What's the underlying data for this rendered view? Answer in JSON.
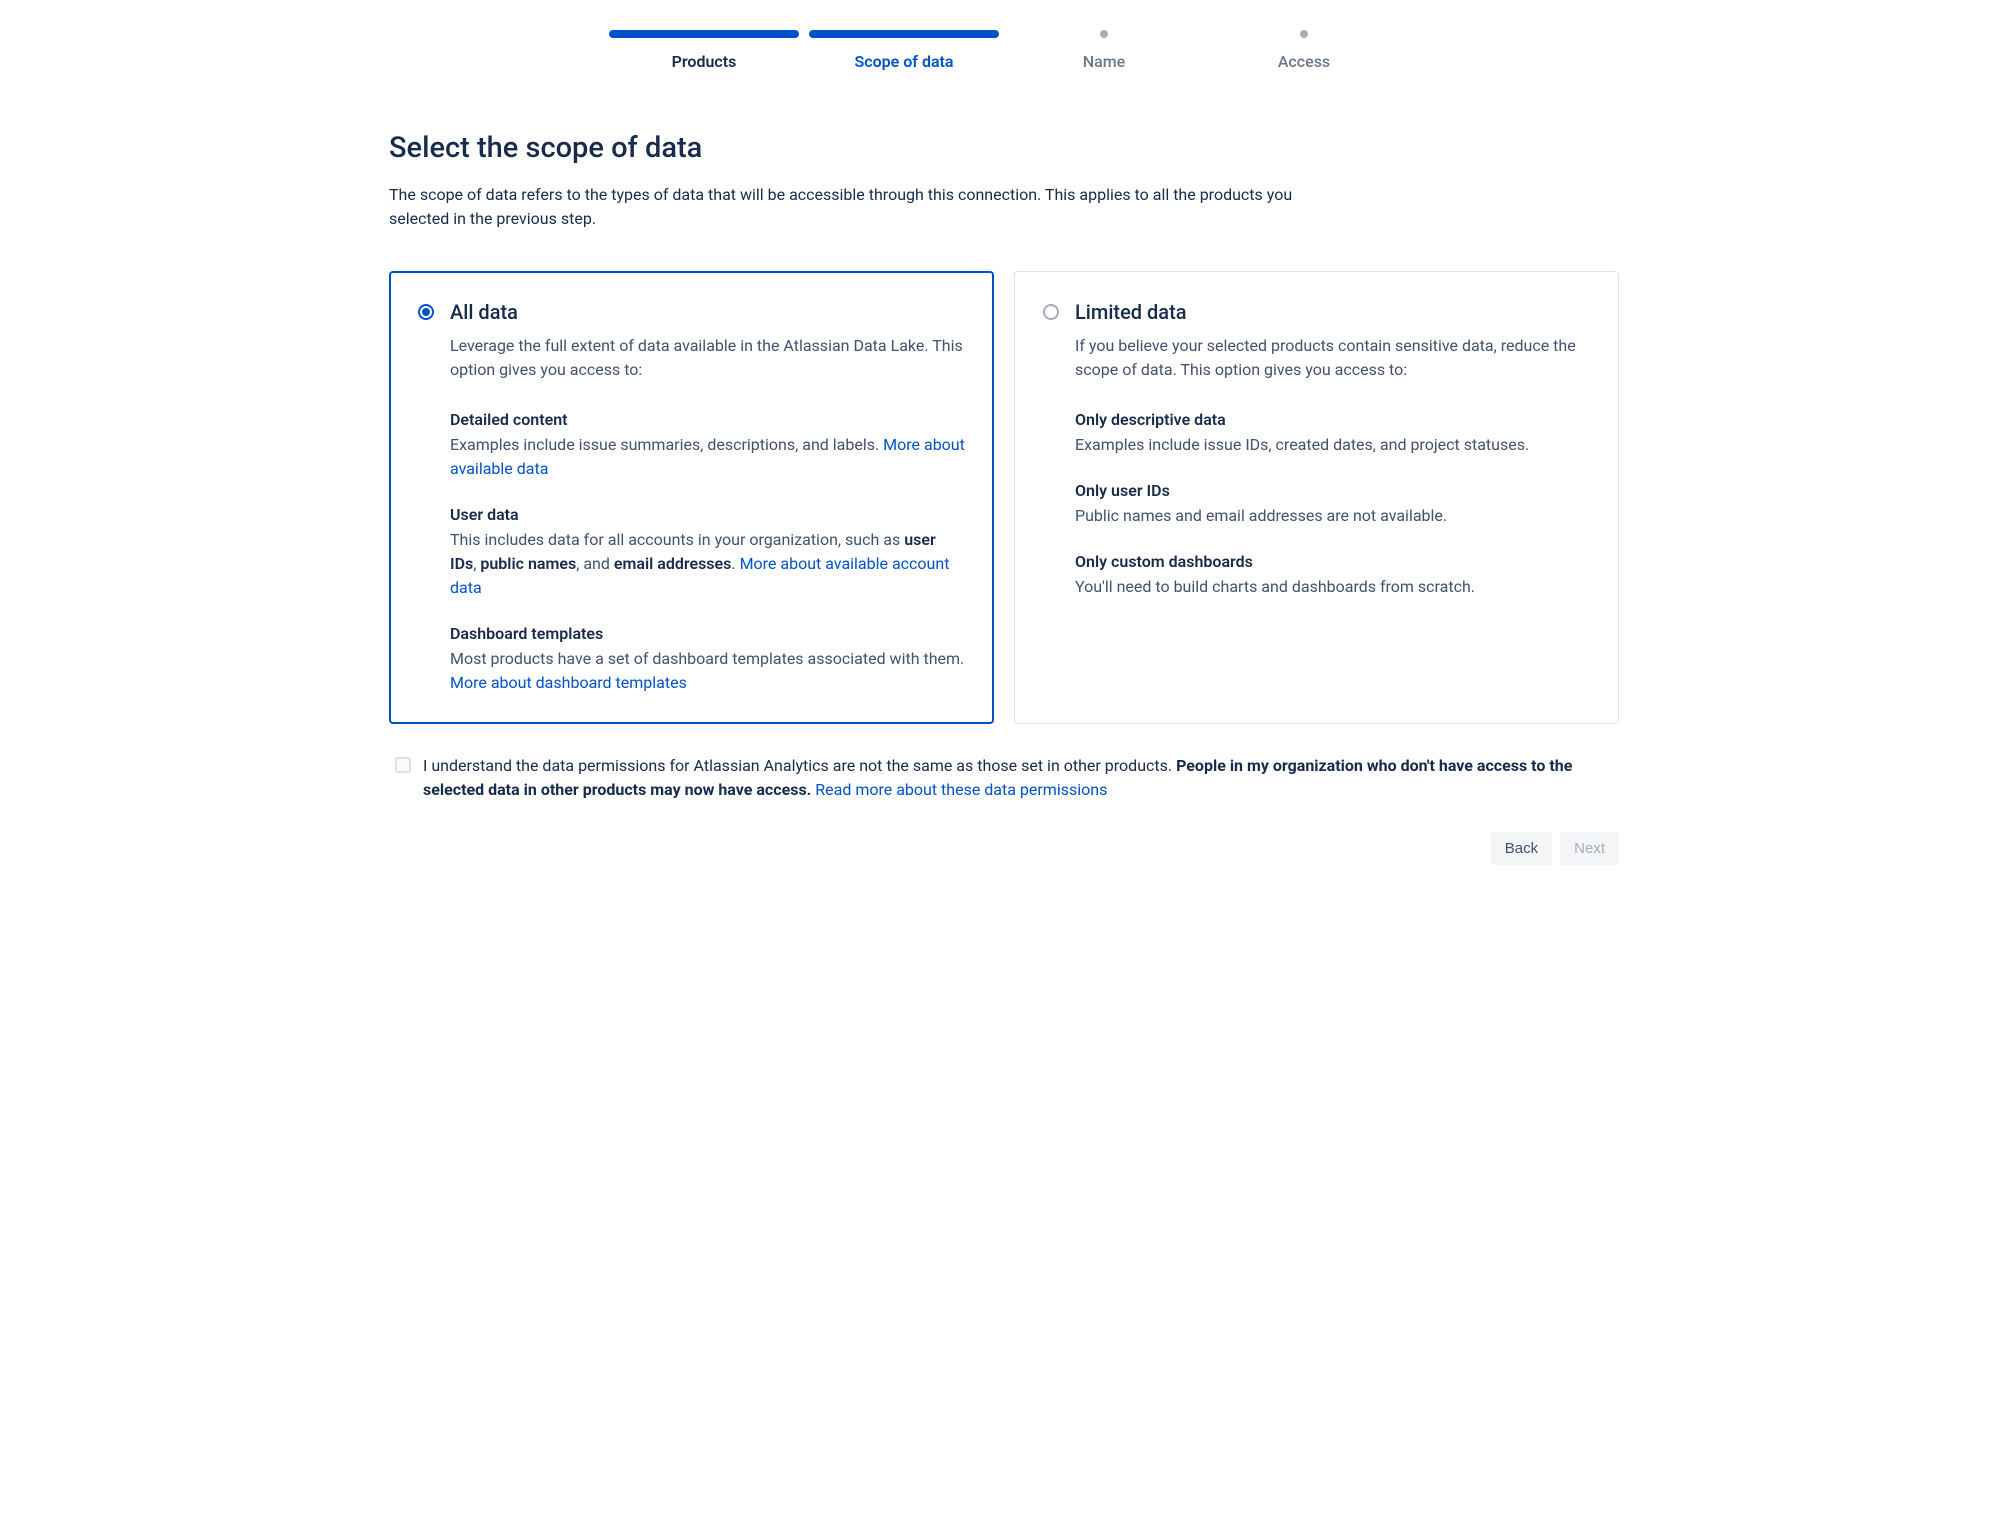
{
  "stepper": {
    "steps": [
      {
        "label": "Products",
        "state": "done"
      },
      {
        "label": "Scope of data",
        "state": "active"
      },
      {
        "label": "Name",
        "state": "upcoming"
      },
      {
        "label": "Access",
        "state": "upcoming"
      }
    ]
  },
  "heading": {
    "title": "Select the scope of data",
    "description": "The scope of data refers to the types of data that will be accessible through this connection. This applies to all the products you selected in the previous step."
  },
  "options": {
    "all_data": {
      "title": "All data",
      "lead": "Leverage the full extent of data available in the Atlassian Data Lake. This option gives you access to:",
      "sections": {
        "detailed": {
          "title": "Detailed content",
          "body_prefix": "Examples include issue summaries, descriptions, and labels. ",
          "link": "More about available data"
        },
        "user": {
          "title": "User data",
          "body_prefix": "This includes data for all accounts in your organization, such as ",
          "bold1": "user IDs",
          "sep1": ", ",
          "bold2": "public names",
          "sep2": ", and ",
          "bold3": "email addresses",
          "suffix": ". ",
          "link": "More about available account data"
        },
        "dashboards": {
          "title": "Dashboard templates",
          "body_prefix": "Most products have a set of dashboard templates associated with them. ",
          "link": "More about dashboard templates"
        }
      }
    },
    "limited_data": {
      "title": "Limited data",
      "lead": "If you believe your selected products contain sensitive data, reduce the scope of data. This option gives you access to:",
      "sections": {
        "descriptive": {
          "title": "Only descriptive data",
          "body": "Examples include issue IDs, created dates, and project statuses."
        },
        "user_ids": {
          "title": "Only user IDs",
          "body": "Public names and email addresses are not available."
        },
        "custom": {
          "title": "Only custom dashboards",
          "body": "You'll need to build charts and dashboards from scratch."
        }
      }
    }
  },
  "consent": {
    "prefix": "I understand the data permissions for Atlassian Analytics are not the same as those set in other products. ",
    "bold": "People in my organization who don't have access to the selected data in other products may now have access.",
    "sep": " ",
    "link": "Read more about these data permissions"
  },
  "footer": {
    "back": "Back",
    "next": "Next"
  }
}
